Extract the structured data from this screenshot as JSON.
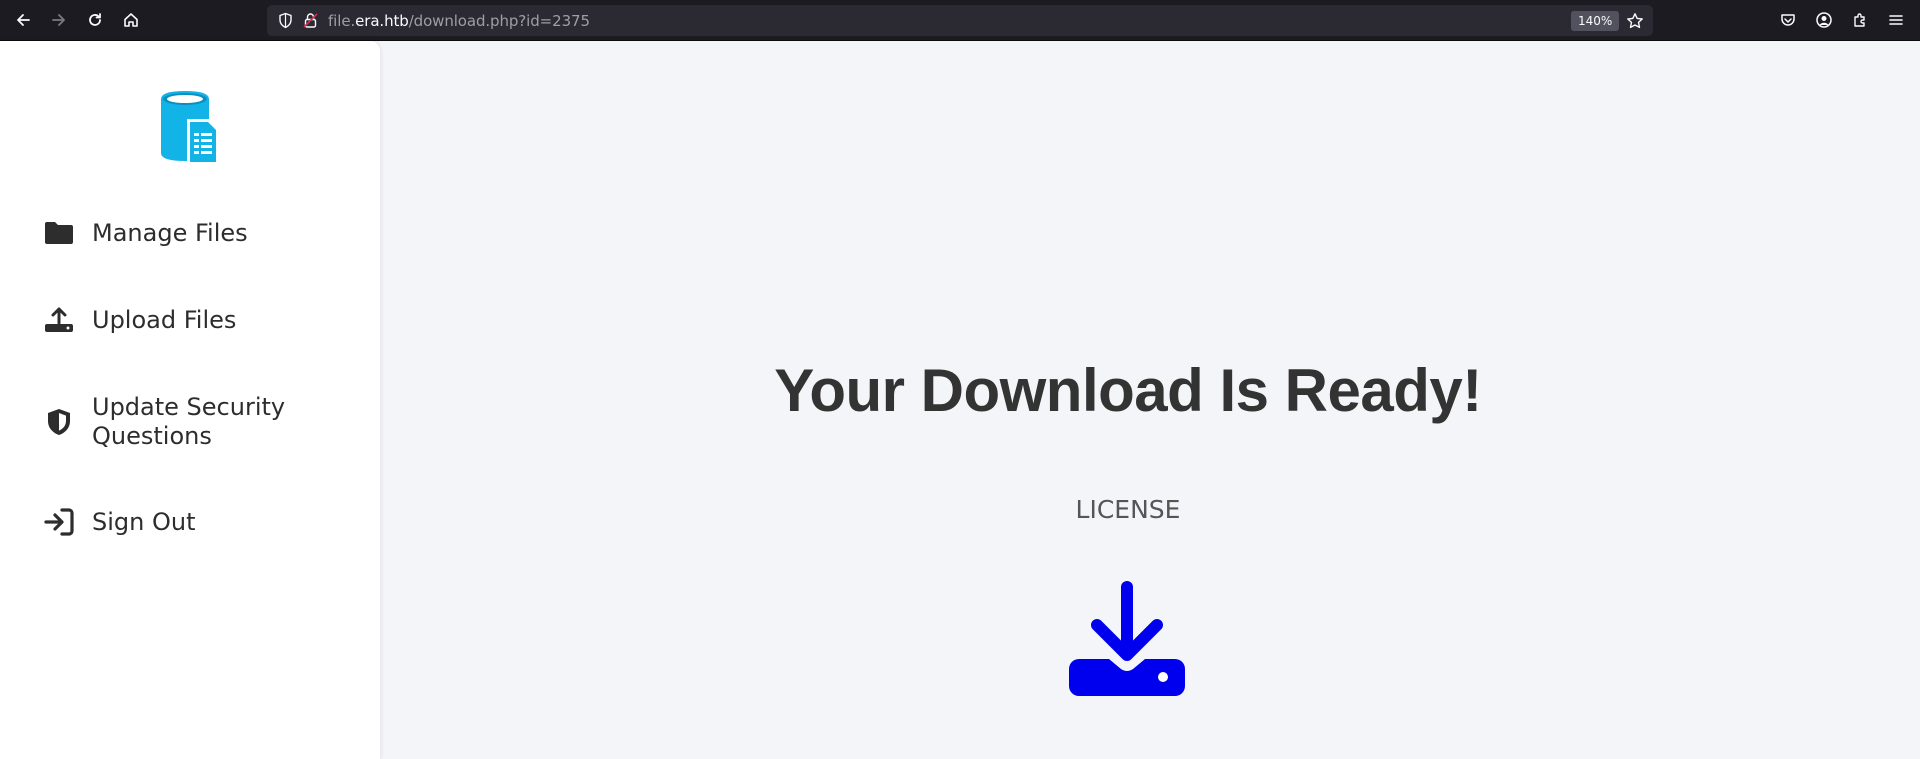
{
  "browser": {
    "url_prefix": "file.",
    "url_host": "era.htb",
    "url_path": "/download.php?id=2375",
    "zoom": "140%"
  },
  "sidebar": {
    "logo_icon": "database-document-icon",
    "items": [
      {
        "label": "Manage Files",
        "icon": "folder-icon"
      },
      {
        "label": "Upload Files",
        "icon": "upload-icon"
      },
      {
        "label": "Update Security Questions",
        "icon": "shield-icon"
      },
      {
        "label": "Sign Out",
        "icon": "sign-out-icon"
      }
    ]
  },
  "main": {
    "heading": "Your Download Is Ready!",
    "filename": "LICENSE",
    "download_icon": "download-icon"
  },
  "colors": {
    "accent_logo": "#12b4e8",
    "download_icon": "#0000ee",
    "text_dark": "#333333"
  }
}
